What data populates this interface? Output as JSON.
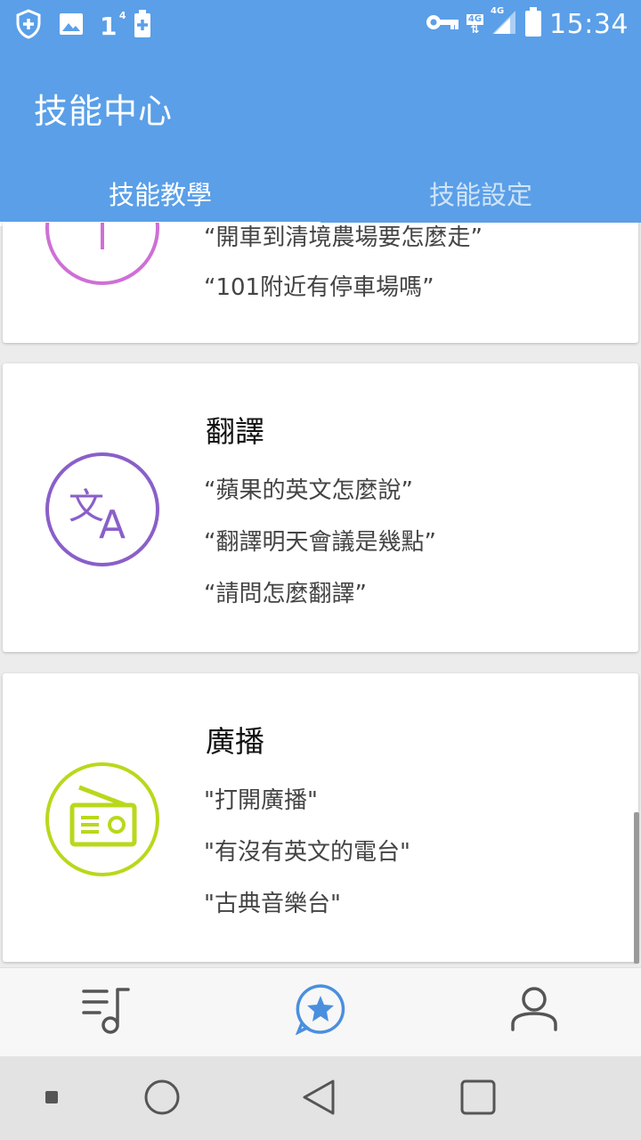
{
  "status_bar": {
    "time": "15:34",
    "sim_indicator": "1",
    "sim_superscript": "4",
    "network_label_top": "4G",
    "network_label_bottom": "4G",
    "icons": [
      "shield-plus-icon",
      "image-icon",
      "battery-saver-icon",
      "key-icon",
      "signal-icon",
      "battery-icon"
    ]
  },
  "appbar": {
    "title": "技能中心",
    "tabs": [
      {
        "label": "技能教學",
        "active": true
      },
      {
        "label": "技能設定",
        "active": false
      }
    ]
  },
  "cards": [
    {
      "title": "",
      "icon": "navigation-icon",
      "icon_color": "#cf6fd6",
      "examples": [
        "“開車到清境農場要怎麼走”",
        "“101附近有停車場嗎”"
      ]
    },
    {
      "title": "翻譯",
      "icon": "translate-icon",
      "icon_color": "#8a5fc9",
      "examples": [
        "“蘋果的英文怎麼說”",
        "“翻譯明天會議是幾點”",
        "“請問怎麼翻譯”"
      ]
    },
    {
      "title": "廣播",
      "icon": "radio-icon",
      "icon_color": "#b9d81b",
      "examples": [
        "\"打開廣播\"",
        "\"有沒有英文的電台\"",
        "\"古典音樂台\""
      ]
    }
  ],
  "bottom_nav": {
    "items": [
      {
        "name": "playlist-icon",
        "active": false
      },
      {
        "name": "skills-star-icon",
        "active": true
      },
      {
        "name": "profile-icon",
        "active": false
      }
    ],
    "active_color": "#4a8fdf"
  },
  "system_nav": [
    "recent-dot-icon",
    "home-circle-icon",
    "back-triangle-icon",
    "overview-square-icon"
  ]
}
